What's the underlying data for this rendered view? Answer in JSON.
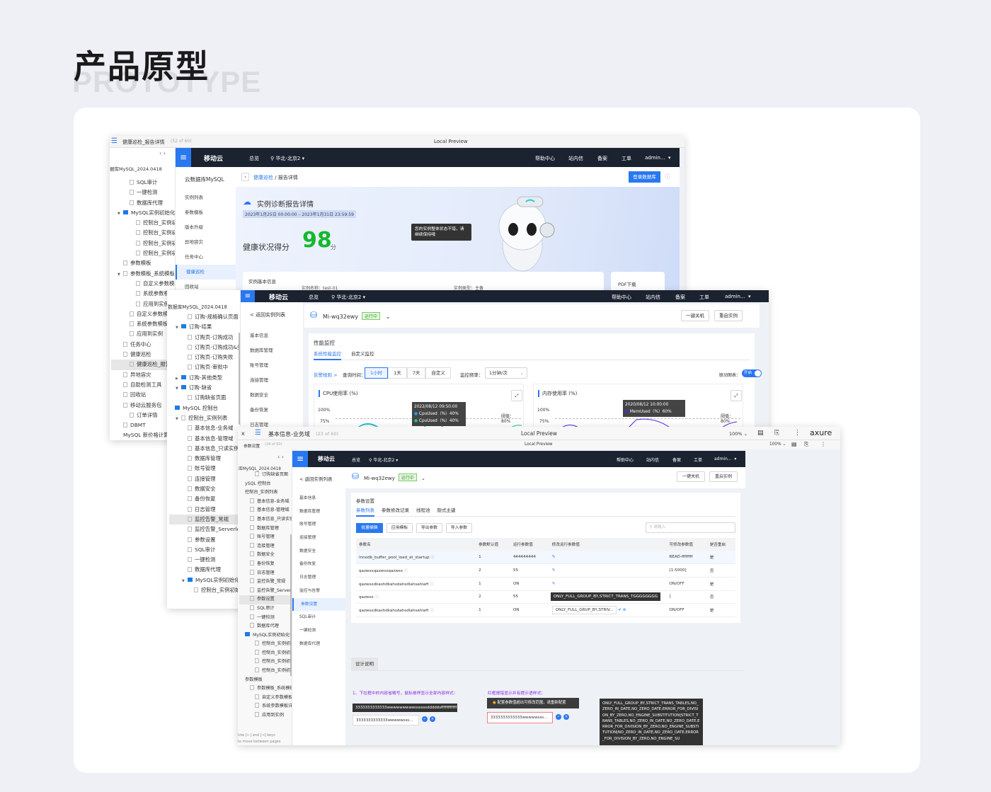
{
  "heading": {
    "title": "产品原型",
    "subtitle": "PROTOTYPE"
  },
  "win1": {
    "page_title": "健康巡检_报告详情",
    "page_count": "(52 of 60)",
    "preview": "Local Preview",
    "project": "据库MySQL_2024.0418",
    "tree": [
      {
        "label": "SQL审计",
        "level": 1,
        "type": "page"
      },
      {
        "label": "一键检测",
        "level": 1,
        "type": "page"
      },
      {
        "label": "数据库代理",
        "level": 1,
        "type": "page"
      },
      {
        "label": "MySQL实例初始化快速",
        "level": 0,
        "type": "folder",
        "open": true
      },
      {
        "label": "控制台_实例初始化",
        "level": 2,
        "type": "page"
      },
      {
        "label": "控制台_实例初始化",
        "level": 2,
        "type": "page"
      },
      {
        "label": "控制台_实例初始化",
        "level": 2,
        "type": "page"
      },
      {
        "label": "控制台_实例初始化",
        "level": 2,
        "type": "page"
      },
      {
        "label": "参数模板",
        "level": 0,
        "type": "page"
      },
      {
        "label": "参数模板_系统模板",
        "level": 0,
        "type": "page",
        "open": true
      },
      {
        "label": "自定义参数模板详情",
        "level": 2,
        "type": "page"
      },
      {
        "label": "系统参数模板详情",
        "level": 2,
        "type": "page"
      },
      {
        "label": "应用到实例",
        "level": 2,
        "type": "page"
      },
      {
        "label": "自定义参数模板详情",
        "level": 1,
        "type": "page"
      },
      {
        "label": "系统参数模板详情",
        "level": 1,
        "type": "page"
      },
      {
        "label": "应用到实例",
        "level": 1,
        "type": "page"
      },
      {
        "label": "任务中心",
        "level": 0,
        "type": "page"
      },
      {
        "label": "健康巡检",
        "level": 0,
        "type": "page"
      },
      {
        "label": "健康巡检_报告详情",
        "level": 1,
        "type": "page",
        "selected": true
      },
      {
        "label": "异地容灾",
        "level": 0,
        "type": "page"
      },
      {
        "label": "自助检测工具",
        "level": 0,
        "type": "page"
      },
      {
        "label": "回收站",
        "level": 0,
        "type": "page"
      },
      {
        "label": "移动云服务包",
        "level": 0,
        "type": "page"
      },
      {
        "label": "订单详情",
        "level": 1,
        "type": "page"
      },
      {
        "label": "DBMT",
        "level": 0,
        "type": "page"
      },
      {
        "label": "MySQL 新价格计算器",
        "level": 0,
        "type": "none"
      }
    ],
    "nav": {
      "logo": "移动云",
      "overview": "总览",
      "region": "华北-北京2",
      "help": "帮助中心",
      "inbox": "站内信",
      "filing": "备案",
      "ticket": "工单",
      "user": "admin..."
    },
    "menu_title": "云数据库MySQL",
    "menu": [
      {
        "label": "实例列表"
      },
      {
        "label": "参数模板"
      },
      {
        "label": "版本升级"
      },
      {
        "label": "异地容灾"
      },
      {
        "label": "任务中心"
      },
      {
        "label": "健康巡检",
        "active": true
      },
      {
        "label": "回收站"
      }
    ],
    "breadcrumb": {
      "parent": "健康巡检",
      "sep": "/",
      "current": "报告详情"
    },
    "login_db": "登录数据库",
    "report": {
      "title": "实例诊断报告详情",
      "range": "2023年1月25日 00:00:00 – 2023年1月31日 23:59:59",
      "score_label": "健康状况得分",
      "score": "98",
      "unit": "分",
      "bubble": "您的实例整体状态不错，请继续保持哦",
      "info_title": "实例基本信息",
      "name": "实例名称：test-01",
      "type": "实例类型：主备",
      "pdf": "PDF下载"
    }
  },
  "win2": {
    "project": "数据库MySQL_2024.0418",
    "tree": [
      {
        "label": "订购-规格确认页面",
        "level": 1,
        "type": "page"
      },
      {
        "label": "订购-结果",
        "level": 0,
        "type": "folder",
        "open": true
      },
      {
        "label": "订购页-订购成功",
        "level": 1,
        "type": "page"
      },
      {
        "label": "订购页-订购成功&失败",
        "level": 1,
        "type": "page"
      },
      {
        "label": "订购页-订购失败",
        "level": 1,
        "type": "page"
      },
      {
        "label": "订购页-审批中",
        "level": 1,
        "type": "page"
      },
      {
        "label": "订购-其他类型",
        "level": 0,
        "type": "folder",
        "open": false
      },
      {
        "label": "订购-缺省",
        "level": 0,
        "type": "folder",
        "open": true
      },
      {
        "label": "订购缺省页面",
        "level": 1,
        "type": "page"
      },
      {
        "label": "MySQL 控制台",
        "level": -1,
        "type": "folder"
      },
      {
        "label": "控制台_实例列表",
        "level": 0,
        "type": "page",
        "open": true
      },
      {
        "label": "基本信息-业务域",
        "level": 1,
        "type": "page"
      },
      {
        "label": "基本信息-管理域",
        "level": 1,
        "type": "page"
      },
      {
        "label": "基本信息_只读实例",
        "level": 1,
        "type": "page"
      },
      {
        "label": "数据库管理",
        "level": 1,
        "type": "page"
      },
      {
        "label": "账号管理",
        "level": 1,
        "type": "page"
      },
      {
        "label": "连接管理",
        "level": 1,
        "type": "page"
      },
      {
        "label": "数据安全",
        "level": 1,
        "type": "page"
      },
      {
        "label": "备份恢复",
        "level": 1,
        "type": "page"
      },
      {
        "label": "日志管理",
        "level": 1,
        "type": "page"
      },
      {
        "label": "监控告警_常规",
        "level": 1,
        "type": "page",
        "selected": true
      },
      {
        "label": "监控告警_Serverless",
        "level": 1,
        "type": "page"
      },
      {
        "label": "参数设置",
        "level": 1,
        "type": "page"
      },
      {
        "label": "SQL审计",
        "level": 1,
        "type": "page"
      },
      {
        "label": "一键检测",
        "level": 1,
        "type": "page"
      },
      {
        "label": "数据库代理",
        "level": 1,
        "type": "page"
      },
      {
        "label": "MySQL实例初始化快速",
        "level": 1,
        "type": "folder",
        "open": true
      },
      {
        "label": "控制台_实例初始化",
        "level": 2,
        "type": "page"
      }
    ],
    "nav": {
      "logo": "移动云",
      "overview": "总览",
      "region": "华北-北京2",
      "help": "帮助中心",
      "inbox": "站内信",
      "filing": "备案",
      "ticket": "工单",
      "user": "admin..."
    },
    "back": "< 返回实例列表",
    "menu": [
      {
        "label": "基本信息"
      },
      {
        "label": "数据库管理"
      },
      {
        "label": "账号管理"
      },
      {
        "label": "连接管理"
      },
      {
        "label": "数据安全"
      },
      {
        "label": "备份恢复"
      },
      {
        "label": "日志管理"
      }
    ],
    "instance": {
      "name": "Mi-wq32ewy",
      "status": "运行中",
      "shutdown": "一键关机",
      "restart": "重启实例"
    },
    "section": "性能监控",
    "tabs": [
      {
        "label": "系统性能监控",
        "active": true
      },
      {
        "label": "自定义监控"
      }
    ],
    "alarm_rule": "告警规则 >",
    "query_label": "查询时间：",
    "ranges": [
      {
        "label": "1小时",
        "active": true
      },
      {
        "label": "1天"
      },
      {
        "label": "7天"
      },
      {
        "label": "自定义"
      }
    ],
    "freq_label": "监控频率：",
    "freq": "1分钟/次",
    "linked_label": "联动图表：",
    "linked": "开启",
    "linked_on": true,
    "cpu": {
      "title": "CPU使用率 (%)",
      "y100": "100%",
      "y75": "75%",
      "threshold": "阈值：80%",
      "tip_time": "2022/08/12 09:50:00",
      "tip_rows": [
        "CpuUsed（%）40%",
        "CpuUsed（%）40%"
      ],
      "colors": [
        "#1aa0ff",
        "#19c9a0"
      ]
    },
    "mem": {
      "title": "内存使用率 (%)",
      "y100": "100%",
      "y75": "75%",
      "threshold": "阈值：80%",
      "tip_time": "2020/08/12 10:00:00",
      "tip_row": "MemUsed（%）60%",
      "color": "#5b22e6"
    }
  },
  "win3": {
    "page_title": "基本信息-业务域",
    "page_count": "(23 of 60)",
    "preview": "Local Preview",
    "zoom": "100%",
    "brand": "axure",
    "inner_title": "参数设置",
    "inner_count": "(34 of 60)",
    "inner_preview": "Local Preview",
    "inner_zoom": "100%",
    "project": "库MySQL_2024.0418",
    "tree": [
      {
        "label": "订购缺省页面",
        "level": 1,
        "type": "page"
      },
      {
        "label": "ySQL 控制台",
        "level": -1,
        "type": "none"
      },
      {
        "label": "控制台_实例列表",
        "level": -1,
        "type": "none"
      },
      {
        "label": "基本信息-业务域",
        "level": 0,
        "type": "page"
      },
      {
        "label": "基本信息-管理域",
        "level": 0,
        "type": "page"
      },
      {
        "label": "基本信息_只读实例",
        "level": 0,
        "type": "page"
      },
      {
        "label": "数据库管理",
        "level": 0,
        "type": "page"
      },
      {
        "label": "账号管理",
        "level": 0,
        "type": "page"
      },
      {
        "label": "连接管理",
        "level": 0,
        "type": "page"
      },
      {
        "label": "数据安全",
        "level": 0,
        "type": "page"
      },
      {
        "label": "备份恢复",
        "level": 0,
        "type": "page"
      },
      {
        "label": "日志管理",
        "level": 0,
        "type": "page"
      },
      {
        "label": "监控告警_常规",
        "level": 0,
        "type": "page"
      },
      {
        "label": "监控告警_Serverless",
        "level": 0,
        "type": "page"
      },
      {
        "label": "参数设置",
        "level": 0,
        "type": "page",
        "selected": true
      },
      {
        "label": "SQL审计",
        "level": 0,
        "type": "page"
      },
      {
        "label": "一键检测",
        "level": 0,
        "type": "page"
      },
      {
        "label": "数据库代理",
        "level": 0,
        "type": "page"
      },
      {
        "label": "MySQL实例初始化快速",
        "level": -1,
        "type": "folder"
      },
      {
        "label": "控制台_实例初始化",
        "level": 1,
        "type": "page"
      },
      {
        "label": "控制台_实例初始化",
        "level": 1,
        "type": "page"
      },
      {
        "label": "控制台_实例初始化",
        "level": 1,
        "type": "page"
      },
      {
        "label": "控制台_实例初始化",
        "level": 1,
        "type": "page"
      },
      {
        "label": "参数模板",
        "level": -1,
        "type": "none"
      },
      {
        "label": "参数模板_系统模板",
        "level": 0,
        "type": "page"
      },
      {
        "label": "自定义参数模板详情",
        "level": 1,
        "type": "page"
      },
      {
        "label": "系统参数模板详情",
        "level": 1,
        "type": "page"
      },
      {
        "label": "应用到实例",
        "level": 1,
        "type": "page"
      }
    ],
    "keys_hint": {
      "use": "Use",
      "and": "and",
      "keys": "keys",
      "line2": "to move between pages"
    },
    "nav": {
      "logo": "移动云",
      "overview": "总览",
      "region": "华北-北京2",
      "help": "帮助中心",
      "inbox": "站内信",
      "filing": "备案",
      "ticket": "工单",
      "user": "admin..."
    },
    "back": "< 返回实例列表",
    "menu": [
      {
        "label": "基本信息"
      },
      {
        "label": "数据库管理"
      },
      {
        "label": "账号管理"
      },
      {
        "label": "连接管理"
      },
      {
        "label": "数据安全"
      },
      {
        "label": "备份恢复"
      },
      {
        "label": "日志管理"
      },
      {
        "label": "监控与告警"
      },
      {
        "label": "参数设置",
        "active": true
      },
      {
        "label": "SQL审计"
      },
      {
        "label": "一键检测"
      },
      {
        "label": "数据库代理"
      }
    ],
    "instance": {
      "name": "Mi-wq32ewy",
      "status": "运行中",
      "shutdown": "一键关机",
      "restart": "重启实例"
    },
    "section": "参数设置",
    "tabs": [
      {
        "label": "参数列表",
        "active": true
      },
      {
        "label": "参数修改记录"
      },
      {
        "label": "线程池"
      },
      {
        "label": "隐式主键"
      }
    ],
    "actions": {
      "batch": "批量编辑",
      "apply": "应用模板",
      "export": "导出参数",
      "import": "导入参数",
      "search_placeholder": "请输入"
    },
    "columns": [
      "参数名",
      "参数默认值",
      "运行参数值",
      "修改运行参数值",
      "可修改参数值",
      "是否重启"
    ],
    "rows": [
      {
        "name": "innodb_buffer_pool_load_at_startup",
        "default": "1",
        "running": "444444444",
        "edit": "icon",
        "range": "READ-ffffffff",
        "restart": "是"
      },
      {
        "name": "qazwsxqazwsxqazwsx",
        "default": "2",
        "running": "55",
        "edit": "icon",
        "range": "[1-5000]",
        "restart": "否"
      },
      {
        "name": "qazwsxdkashdkahsdahsdlahsahlaH",
        "default": "1",
        "running": "ON",
        "edit": "icon",
        "range": "ON/OFF",
        "restart": "是"
      },
      {
        "name": "qazwsx",
        "default": "2",
        "running": "55",
        "edit": "tooltip",
        "edit_text": "ONLY_FULL_GROUP_BY,STRICT_TRANS_TGGGGGGGG",
        "range": "]",
        "restart": "否"
      },
      {
        "name": "qazwsxdkashdkahsdahsdlahsahlaH",
        "default": "1",
        "running": "ON",
        "edit": "input",
        "edit_text": "ONLY_FULL_GRUP_BY,STRIV...",
        "range": "ON/OFF",
        "restart": "是"
      }
    ],
    "design": {
      "tab": "设计说明",
      "note1": "1、下拉框中的内容省略号，鼠标悬停显示全部内容样式：",
      "tip1": "3333333333333wwwwwwwwwssssssdddddsffffffffffff",
      "input1": "3333333333333wwwwwsss...",
      "note2": "红框报错显示并有提示语样式：",
      "warn": "配置参数值超出可修改范围，请重新配置",
      "input2": "3333333333333wwwwwsss...",
      "long_tip": "ONLY_FULL_GROUP_BY,STRICT_TRANS_TABLES,NO_ZERO_IN_DATE,NO_ZERO_DATE,ERROR_FOR_DIVISION_BY_ZERO,NO_ENGINE_SUBSTITUTION|STRICT_TRANS_TABLES,NO_ZERO_IN_DATE,NO_ZERO_DATE,ERROR_FOR_DIVISION_BY_ZERO,NO_ENGINE_SUBSTITUTION|NO_ZERO_IN_DATE,NO_ZERO_DATE,ERROR_FOR_DIVISION_BY_ZERO,NO_ENGINE_SU"
    },
    "colors": {
      "accent": "#2a78f0",
      "error": "#f08080",
      "note": "#8a2be2"
    }
  }
}
